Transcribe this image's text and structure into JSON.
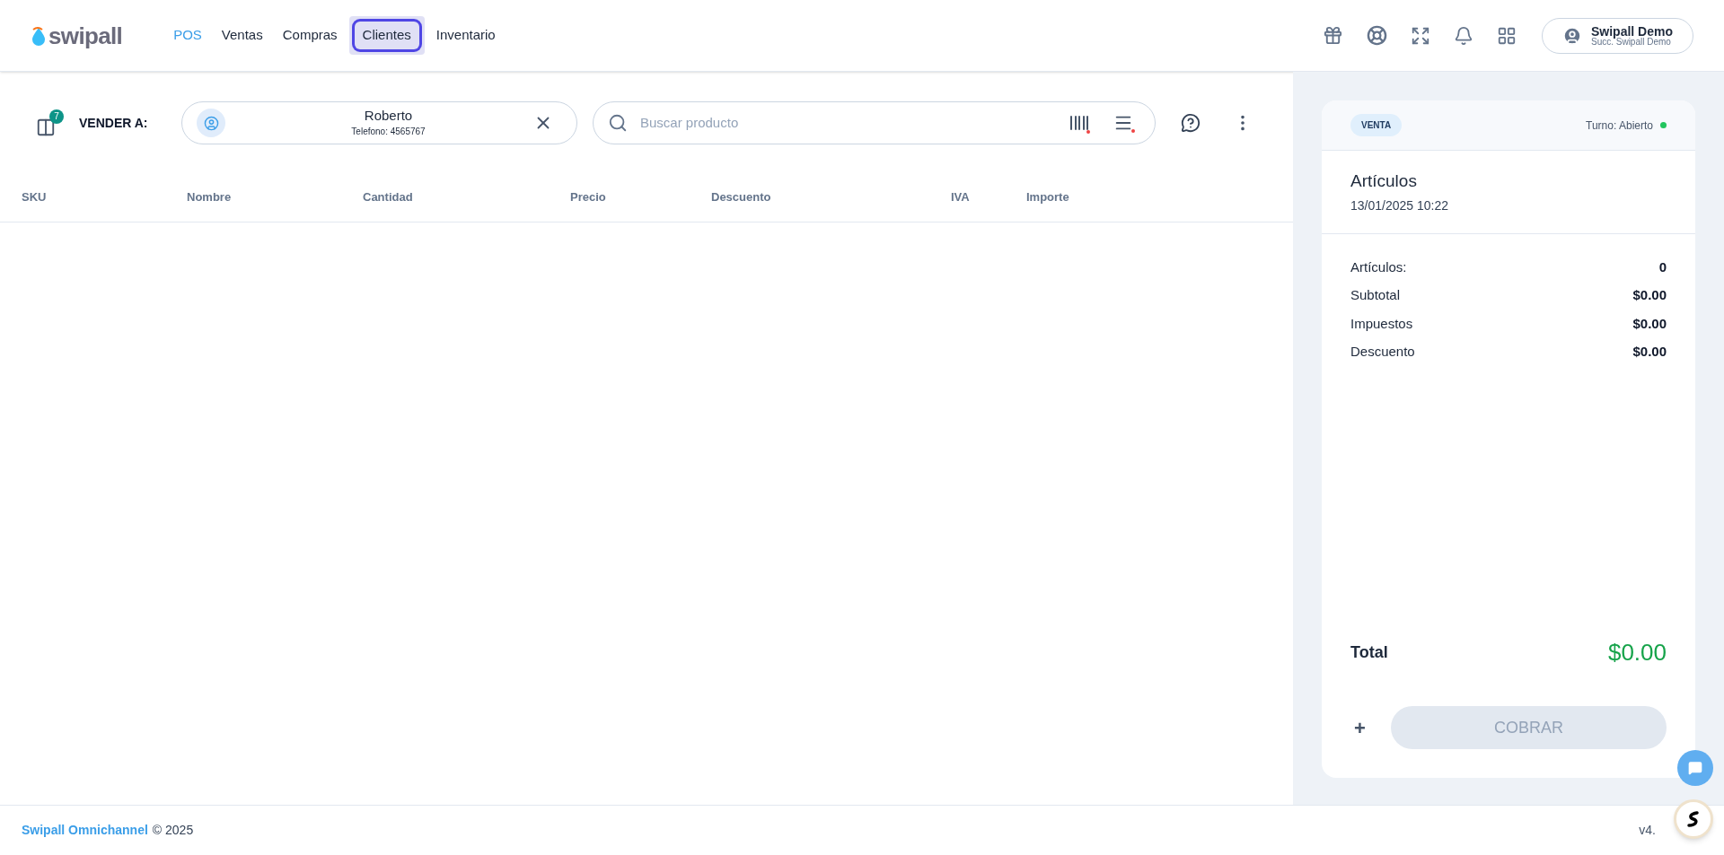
{
  "header": {
    "logo": "swipall",
    "nav": [
      {
        "label": "POS",
        "selected": true,
        "focused": false
      },
      {
        "label": "Ventas",
        "selected": false,
        "focused": false
      },
      {
        "label": "Compras",
        "selected": false,
        "focused": false
      },
      {
        "label": "Clientes",
        "selected": false,
        "focused": true
      },
      {
        "label": "Inventario",
        "selected": false,
        "focused": false
      }
    ],
    "user": {
      "name": "Swipall Demo",
      "branch": "Succ. Swipall Demo"
    }
  },
  "toolbar": {
    "tickets_badge": "7",
    "sell_to_label": "VENDER A:",
    "customer": {
      "name": "Roberto",
      "phone": "Telefono: 4565767"
    },
    "search": {
      "placeholder": "Buscar producto"
    }
  },
  "table": {
    "columns": [
      "SKU",
      "Nombre",
      "Cantidad",
      "Precio",
      "Descuento",
      "IVA",
      "Importe"
    ]
  },
  "summary": {
    "badge": "VENTA",
    "shift": {
      "label": "Turno: Abierto",
      "color": "#22c55e"
    },
    "title": "Artículos",
    "datetime": "13/01/2025 10:22",
    "rows": [
      {
        "label": "Artículos:",
        "value": "0"
      },
      {
        "label": "Subtotal",
        "value": "$0.00"
      },
      {
        "label": "Impuestos",
        "value": "$0.00"
      },
      {
        "label": "Descuento",
        "value": "$0.00"
      }
    ],
    "total_label": "Total",
    "total_value": "$0.00",
    "add_symbol": "+",
    "charge_button": {
      "label": "COBRAR",
      "disabled": true
    }
  },
  "footer": {
    "brand": "Swipall Omnichannel",
    "copyright": "© 2025",
    "version": "v4."
  }
}
